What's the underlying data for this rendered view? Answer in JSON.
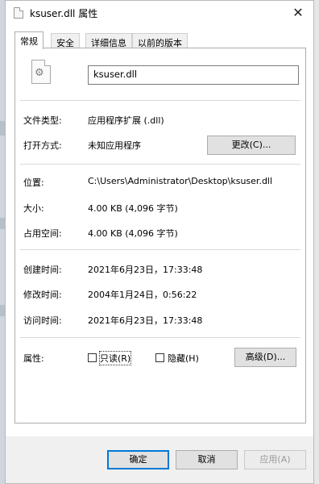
{
  "window": {
    "title": "ksuser.dll 属性"
  },
  "tabs": [
    {
      "label": "常规"
    },
    {
      "label": "安全"
    },
    {
      "label": "详细信息"
    },
    {
      "label": "以前的版本"
    }
  ],
  "general": {
    "file_name": "ksuser.dll",
    "file_type_label": "文件类型:",
    "file_type_value": "应用程序扩展 (.dll)",
    "open_with_label": "打开方式:",
    "open_with_value": "未知应用程序",
    "change_button": "更改(C)...",
    "location_label": "位置:",
    "location_value": "C:\\Users\\Administrator\\Desktop\\ksuser.dll",
    "size_label": "大小:",
    "size_value": "4.00 KB (4,096 字节)",
    "size_on_disk_label": "占用空间:",
    "size_on_disk_value": "4.00 KB (4,096 字节)",
    "created_label": "创建时间:",
    "created_value": "2021年6月23日，17:33:48",
    "modified_label": "修改时间:",
    "modified_value": "2004年1月24日，0:56:22",
    "accessed_label": "访问时间:",
    "accessed_value": "2021年6月23日，17:33:48",
    "attributes_label": "属性:",
    "readonly_label": "只读(R)",
    "hidden_label": "隐藏(H)",
    "advanced_button": "高级(D)..."
  },
  "footer": {
    "ok": "确定",
    "cancel": "取消",
    "apply": "应用(A)"
  },
  "colors": {
    "accent": "#0078d7"
  }
}
